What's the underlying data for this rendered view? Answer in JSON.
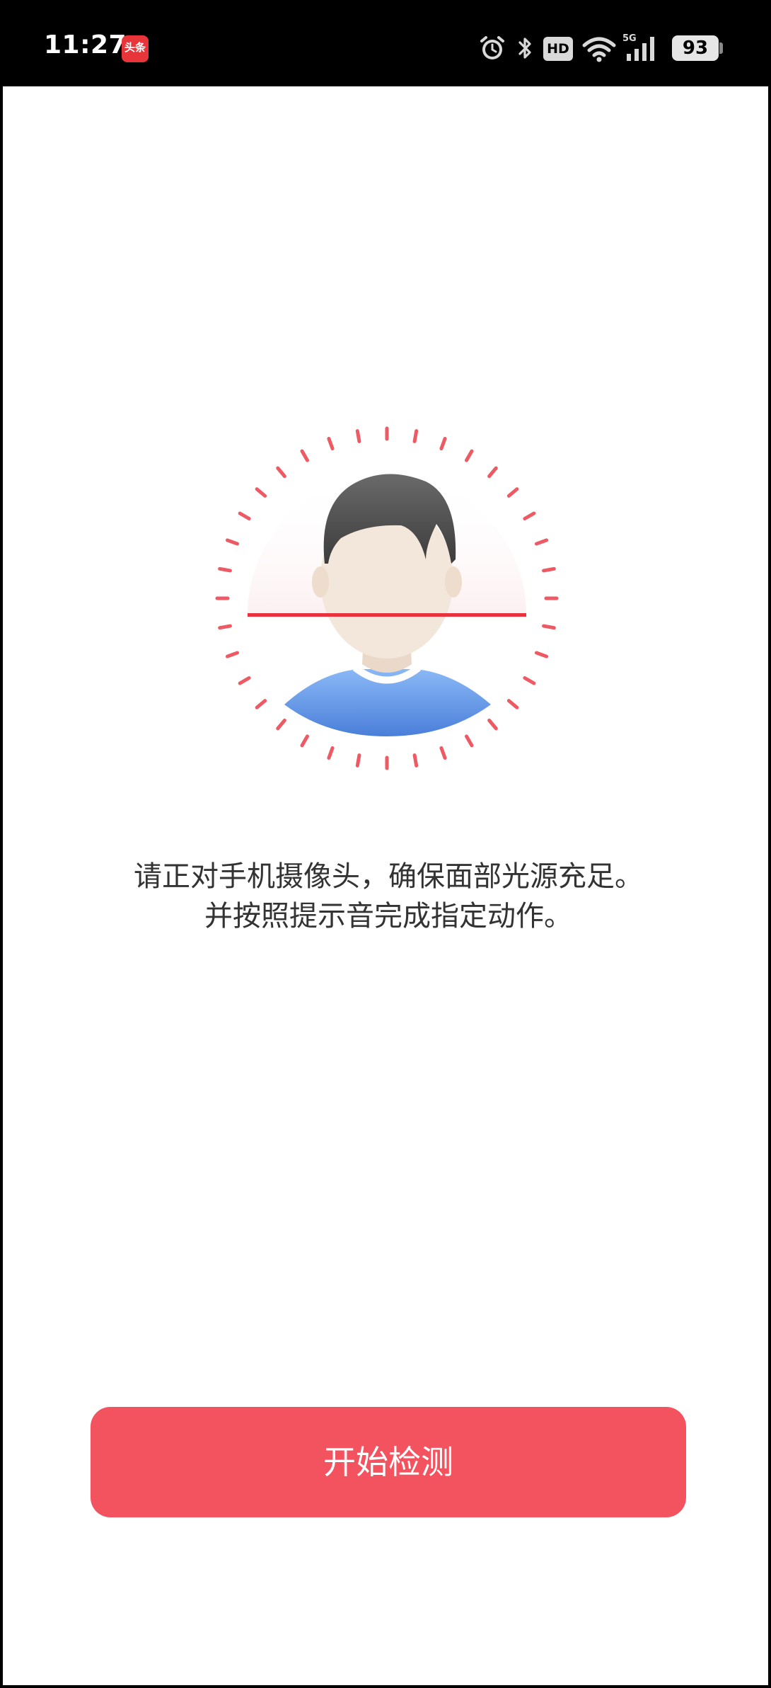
{
  "status_bar": {
    "time": "11:27",
    "app_badge": "头条",
    "hd_label": "HD",
    "network_label": "5G",
    "battery": "93",
    "icons": [
      "alarm-icon",
      "bluetooth-icon",
      "hd-icon",
      "wifi-icon",
      "signal-5g-icon",
      "battery-icon"
    ]
  },
  "face_graphic": {
    "icon": "face-scan-illustration",
    "colors": {
      "ticks": "#ee5a64",
      "scan_line": "#e8323d",
      "hair": "#555555",
      "skin": "#f3e3d6",
      "shirt": "#5a93ee"
    }
  },
  "instructions": {
    "line1": "请正对手机摄像头，确保面部光源充足。",
    "line2": "并按照提示音完成指定动作。"
  },
  "actions": {
    "start_label": "开始检测",
    "accent": "#f3525f"
  }
}
